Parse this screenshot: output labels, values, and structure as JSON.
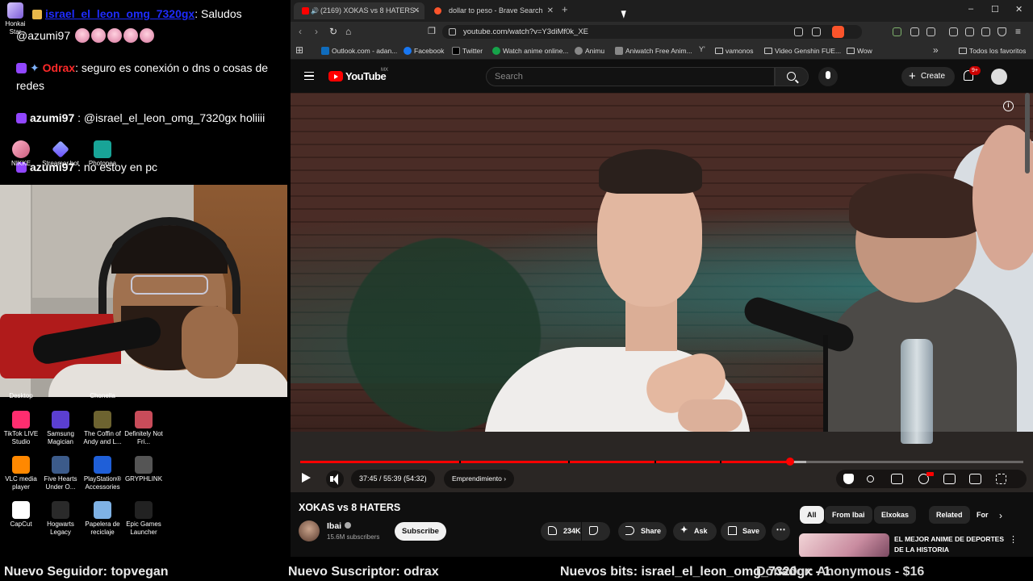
{
  "chat": {
    "messages": [
      {
        "user": "israel_el_leon_omg_7320gx",
        "text": ": Saludos",
        "second_line": "@azumi97"
      },
      {
        "user": "Odrax",
        "text": ": seguro es conexión o dns o cosas de redes"
      },
      {
        "user": "azumi97",
        "text": ": @israel_el_leon_omg_7320gx holiiii"
      },
      {
        "user": "azumi97",
        "text": ": no estoy en pc"
      }
    ]
  },
  "desktop": {
    "top_left_label": "Honkai Star",
    "top_icons": [
      "NIKKE",
      "Streamer.bot",
      "Photopea"
    ],
    "cut_labels": [
      "Desktop",
      "Chonella"
    ],
    "icons": [
      {
        "label": "TikTok LIVE Studio",
        "color": "#ff2d6f"
      },
      {
        "label": "Samsung Magician",
        "color": "#5b3fd1"
      },
      {
        "label": "The Coffin of Andy and L...",
        "color": "#6d6330"
      },
      {
        "label": "Definitely Not Fri...",
        "color": "#c84c5a"
      },
      {
        "label": "VLC media player",
        "color": "#ff8800"
      },
      {
        "label": "Five Hearts Under O...",
        "color": "#3c5b8a"
      },
      {
        "label": "PlayStation® Accessories",
        "color": "#1f5fd8"
      },
      {
        "label": "GRYPHLINK",
        "color": "#555555"
      },
      {
        "label": "CapCut",
        "color": "#ffffff"
      },
      {
        "label": "Hogwarts Legacy",
        "color": "#2a2a2a"
      },
      {
        "label": "Papelera de reciclaje",
        "color": "#7fb2e5"
      },
      {
        "label": "Epic Games Launcher",
        "color": "#222222"
      }
    ]
  },
  "browser": {
    "tabs": [
      {
        "label": "(2169) XOKAS vs 8 HATERS -",
        "favicon_color": "#ff0000",
        "active": true
      },
      {
        "label": "dollar to peso - Brave Search",
        "favicon_color": "#fb542b",
        "active": false
      }
    ],
    "new_tab": "+",
    "url": "youtube.com/watch?v=Y3diMf0k_XE",
    "bookmarks": [
      {
        "label": "Outlook.com - adan...",
        "color": "#0f6cbd"
      },
      {
        "label": "Facebook",
        "color": "#1877f2"
      },
      {
        "label": "Twitter",
        "color": "#000000"
      },
      {
        "label": "Watch anime online...",
        "color": "#16a34a"
      },
      {
        "label": "Animu",
        "color": "#888888"
      },
      {
        "label": "Aniwatch Free Anim...",
        "color": "#888888"
      },
      {
        "label": "vamonos",
        "folder": true
      },
      {
        "label": "Video Genshin FUE...",
        "folder": true
      },
      {
        "label": "Wow",
        "folder": true
      },
      {
        "label": "Todos los favoritos",
        "folder": true
      }
    ]
  },
  "youtube": {
    "brand": "YouTube",
    "country": "MX",
    "search_placeholder": "Search",
    "create_label": "Create",
    "notif_count": "9+",
    "player": {
      "time_text": "37:45 / 55:39 (54:32)",
      "chapter": "Emprendimiento",
      "progress_played": 0.678,
      "progress_loaded": 0.7
    },
    "video_title": "XOKAS vs 8 HATERS",
    "channel_name": "Ibai",
    "subscribers": "15.6M subscribers",
    "subscribe_label": "Subscribe",
    "likes": "234K",
    "share_label": "Share",
    "ask_label": "Ask",
    "save_label": "Save",
    "chips": [
      "All",
      "From Ibai",
      "Elxokas",
      "Related",
      "For yo"
    ],
    "recommended_title": "EL MEJOR ANIME DE DEPORTES DE LA HISTORIA"
  },
  "ticker": [
    "Nuevo Seguidor: topvegan",
    "Nuevo Suscriptor: odrax",
    "Nuevos bits: israel_el_leon_omg_7320gx - 1",
    "Donador: Anonymous - $16"
  ],
  "colors": {
    "accent_red": "#ff0000",
    "twitch_purple": "#9146ff"
  }
}
